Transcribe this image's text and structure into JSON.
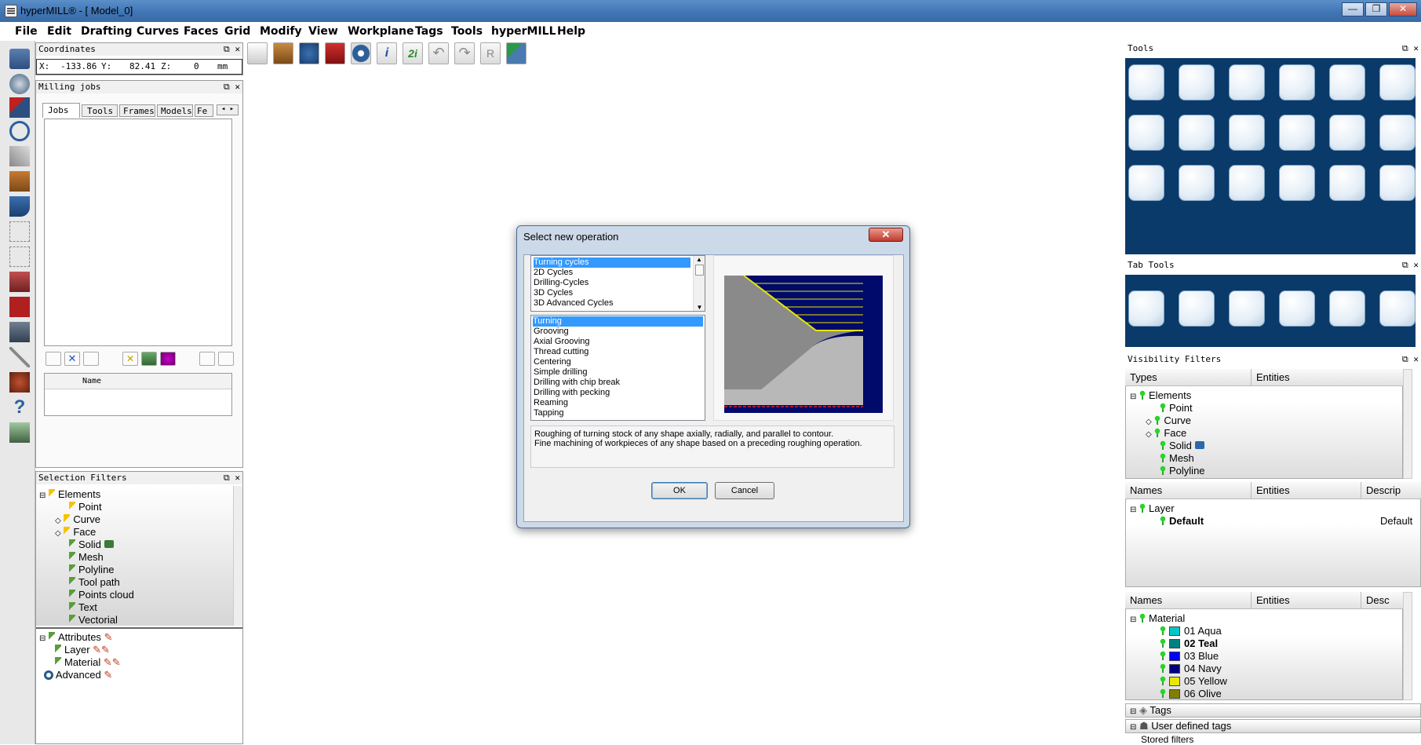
{
  "window": {
    "title": "hyperMILL® - [ Model_0]",
    "min": "—",
    "restore": "❐",
    "close": "✕"
  },
  "menu": [
    "File",
    "Edit",
    "Drafting",
    "Curves",
    "Faces",
    "Grid",
    "Modify",
    "View",
    "Workplane",
    "Tags",
    "Tools",
    "hyperMILL",
    "Help"
  ],
  "coordinates": {
    "title": "Coordinates",
    "x_label": "X:",
    "x": "-133.86",
    "y_label": "Y:",
    "y": "82.41",
    "z_label": "Z:",
    "z": "0",
    "unit": "mm"
  },
  "milling_jobs": {
    "title": "Milling jobs",
    "tabs": [
      "Jobs",
      "Tools",
      "Frames",
      "Models",
      "Fe"
    ],
    "name_col": "Name"
  },
  "selection_filters": {
    "title": "Selection Filters",
    "elements": [
      "Elements",
      "Point",
      "Curve",
      "Face",
      "Solid",
      "Mesh",
      "Polyline",
      "Tool path",
      "Points cloud",
      "Text",
      "Vectorial"
    ],
    "attributes": [
      "Attributes",
      "Layer",
      "Material"
    ],
    "advanced": "Advanced"
  },
  "tools_panel": {
    "title": "Tools"
  },
  "tab_tools": {
    "title": "Tab Tools"
  },
  "visibility": {
    "title": "Visibility Filters",
    "types_header": [
      "Types",
      "Entities"
    ],
    "types": [
      "Elements",
      "Point",
      "Curve",
      "Face",
      "Solid",
      "Mesh",
      "Polyline"
    ],
    "names_header": [
      "Names",
      "Entities",
      "Descrip"
    ],
    "layer_root": "Layer",
    "layer_default": "Default",
    "layer_default_desc": "Default",
    "names_header2": [
      "Names",
      "Entities",
      "Desc"
    ],
    "material_root": "Material",
    "materials": [
      {
        "name": "01 Aqua",
        "color": "#00c8c8"
      },
      {
        "name": "02 Teal",
        "color": "#008080"
      },
      {
        "name": "03 Blue",
        "color": "#0000ff"
      },
      {
        "name": "04 Navy",
        "color": "#000080"
      },
      {
        "name": "05 Yellow",
        "color": "#e8e800"
      },
      {
        "name": "06 Olive",
        "color": "#808000"
      }
    ],
    "tags": "Tags",
    "user_tags": "User defined tags",
    "stored": "Stored filters"
  },
  "dialog": {
    "title": "Select new operation",
    "categories": [
      "Turning cycles",
      "2D Cycles",
      "Drilling-Cycles",
      "3D Cycles",
      "3D Advanced Cycles"
    ],
    "operations": [
      "Turning",
      "Grooving",
      "Axial Grooving",
      "Thread cutting",
      "Centering",
      "Simple drilling",
      "Drilling with chip break",
      "Drilling with pecking",
      "Reaming",
      "Tapping"
    ],
    "description_1": "Roughing of turning stock of any shape axially, radially, and parallel to contour.",
    "description_2": "Fine machining of workpieces of any shape based on a preceding roughing operation.",
    "ok": "OK",
    "cancel": "Cancel"
  }
}
